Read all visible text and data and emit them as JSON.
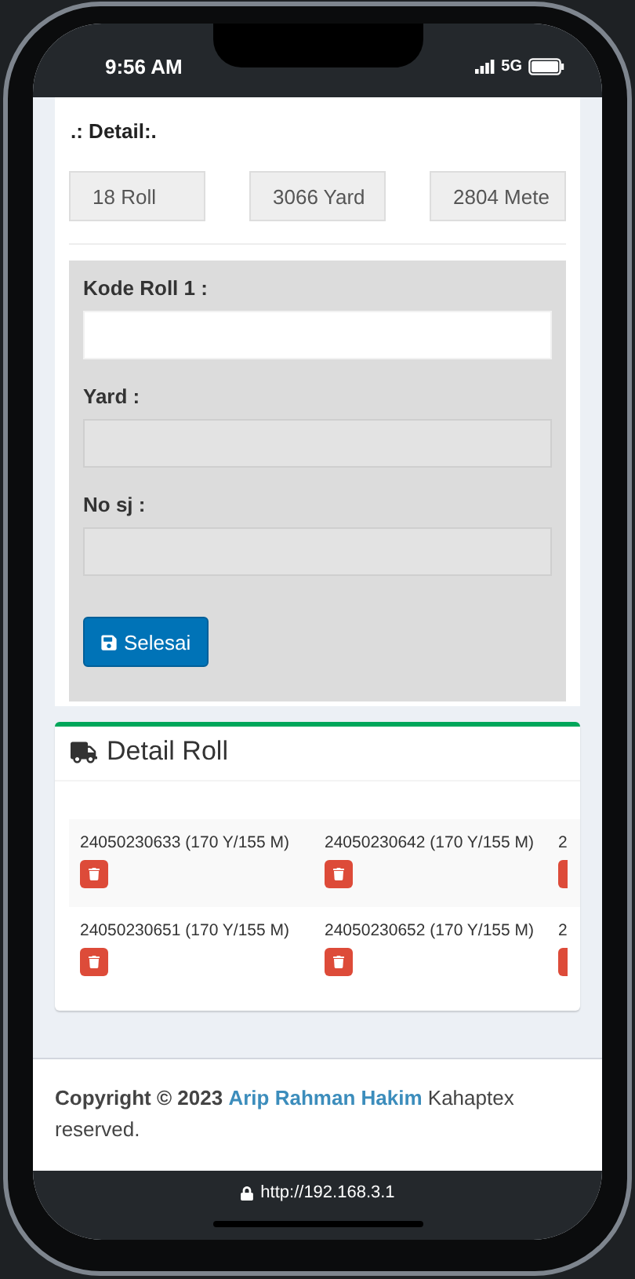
{
  "status_bar": {
    "time": "9:56 AM",
    "network": "5G"
  },
  "detail": {
    "title": ".: Detail:.",
    "summary": [
      "18 Roll",
      "3066 Yard",
      "2804 Mete"
    ]
  },
  "form": {
    "fields": [
      {
        "label": "Kode Roll 1 :",
        "disabled": false
      },
      {
        "label": "Yard :",
        "disabled": true
      },
      {
        "label": "No sj :",
        "disabled": true
      }
    ],
    "button": "Selesai"
  },
  "detail_roll": {
    "title": "Detail Roll",
    "rows": [
      [
        "24050230633 (170 Y/155 M)",
        "24050230642 (170 Y/155 M)",
        "2"
      ],
      [
        "24050230651 (170 Y/155 M)",
        "24050230652 (170 Y/155 M)",
        "2"
      ]
    ]
  },
  "footer": {
    "prefix": "Copyright © 2023",
    "author": "Arip Rahman Hakim",
    "suffix": "Kahaptex reserved."
  },
  "url": "http://192.168.3.1"
}
